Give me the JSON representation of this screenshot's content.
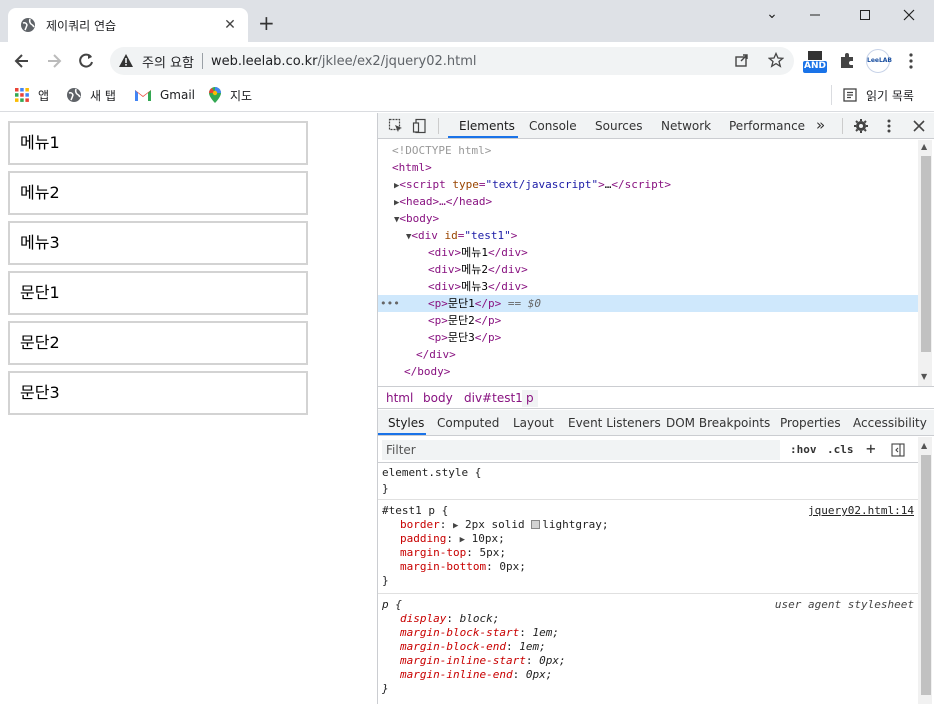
{
  "browser": {
    "tab_title": "제이쿼리 연습",
    "tab_close": "✕",
    "new_tab": "+",
    "window_controls": {
      "minimize": "⌄",
      "restore": "—",
      "maximize": "☐",
      "close": "✕"
    },
    "security_warning": "주의 요함",
    "url_host": "web.leelab.co.kr",
    "url_path": "/jklee/ex2/jquery02.html",
    "ext_and_label": "AND",
    "ext_leelab_label": "LeeLAB",
    "bookmarks": [
      {
        "label": "앱",
        "icon": "apps-grid-icon"
      },
      {
        "label": "새 탭",
        "icon": "globe-icon"
      },
      {
        "label": "Gmail",
        "icon": "gmail-icon"
      },
      {
        "label": "지도",
        "icon": "maps-pin-icon"
      }
    ],
    "reading_list": "읽기 목록",
    "accent_color": "#1a73e8"
  },
  "page": {
    "boxes": [
      "메뉴1",
      "메뉴2",
      "메뉴3",
      "문단1",
      "문단2",
      "문단3"
    ]
  },
  "devtools": {
    "tabs": [
      "Elements",
      "Console",
      "Sources",
      "Network",
      "Performance"
    ],
    "more_tabs": "»",
    "active_tab": "Elements",
    "dom": {
      "doctype": "<!DOCTYPE html>",
      "html_open": "<html>",
      "script_attr": "type",
      "script_type": "\"text/javascript\"",
      "head": "<head>…</head>",
      "body_open": "<body>",
      "div_id": "\"test1\"",
      "children": [
        {
          "tag": "div",
          "text": "메뉴1"
        },
        {
          "tag": "div",
          "text": "메뉴2"
        },
        {
          "tag": "div",
          "text": "메뉴3"
        },
        {
          "tag": "p",
          "text": "문단1"
        },
        {
          "tag": "p",
          "text": "문단2"
        },
        {
          "tag": "p",
          "text": "문단3"
        }
      ],
      "selected_suffix": " == $0",
      "div_close": "</div>",
      "body_close": "</body>",
      "dots": "•••"
    },
    "breadcrumbs": [
      "html",
      "body",
      "div#test1",
      "p"
    ],
    "sub_tabs": [
      "Styles",
      "Computed",
      "Layout",
      "Event Listeners",
      "DOM Breakpoints",
      "Properties",
      "Accessibility"
    ],
    "filter_placeholder": "Filter",
    "hov": ":hov",
    "cls": ".cls",
    "plus": "+",
    "styles": {
      "element_style": "element.style {",
      "close_brace": "}",
      "rule1_selector": "#test1 p {",
      "rule1_source": "jquery02.html:14",
      "rule1_props": [
        {
          "name": "border",
          "value": "2px solid",
          "swatch_value": "lightgray;",
          "expand": true
        },
        {
          "name": "padding",
          "value": "10px;",
          "expand": true
        },
        {
          "name": "margin-top",
          "value": "5px;"
        },
        {
          "name": "margin-bottom",
          "value": "0px;"
        }
      ],
      "rule2_selector": "p {",
      "rule2_source": "user agent stylesheet",
      "rule2_props": [
        {
          "name": "display",
          "value": "block;"
        },
        {
          "name": "margin-block-start",
          "value": "1em;"
        },
        {
          "name": "margin-block-end",
          "value": "1em;"
        },
        {
          "name": "margin-inline-start",
          "value": "0px;"
        },
        {
          "name": "margin-inline-end",
          "value": "0px;"
        }
      ]
    }
  }
}
